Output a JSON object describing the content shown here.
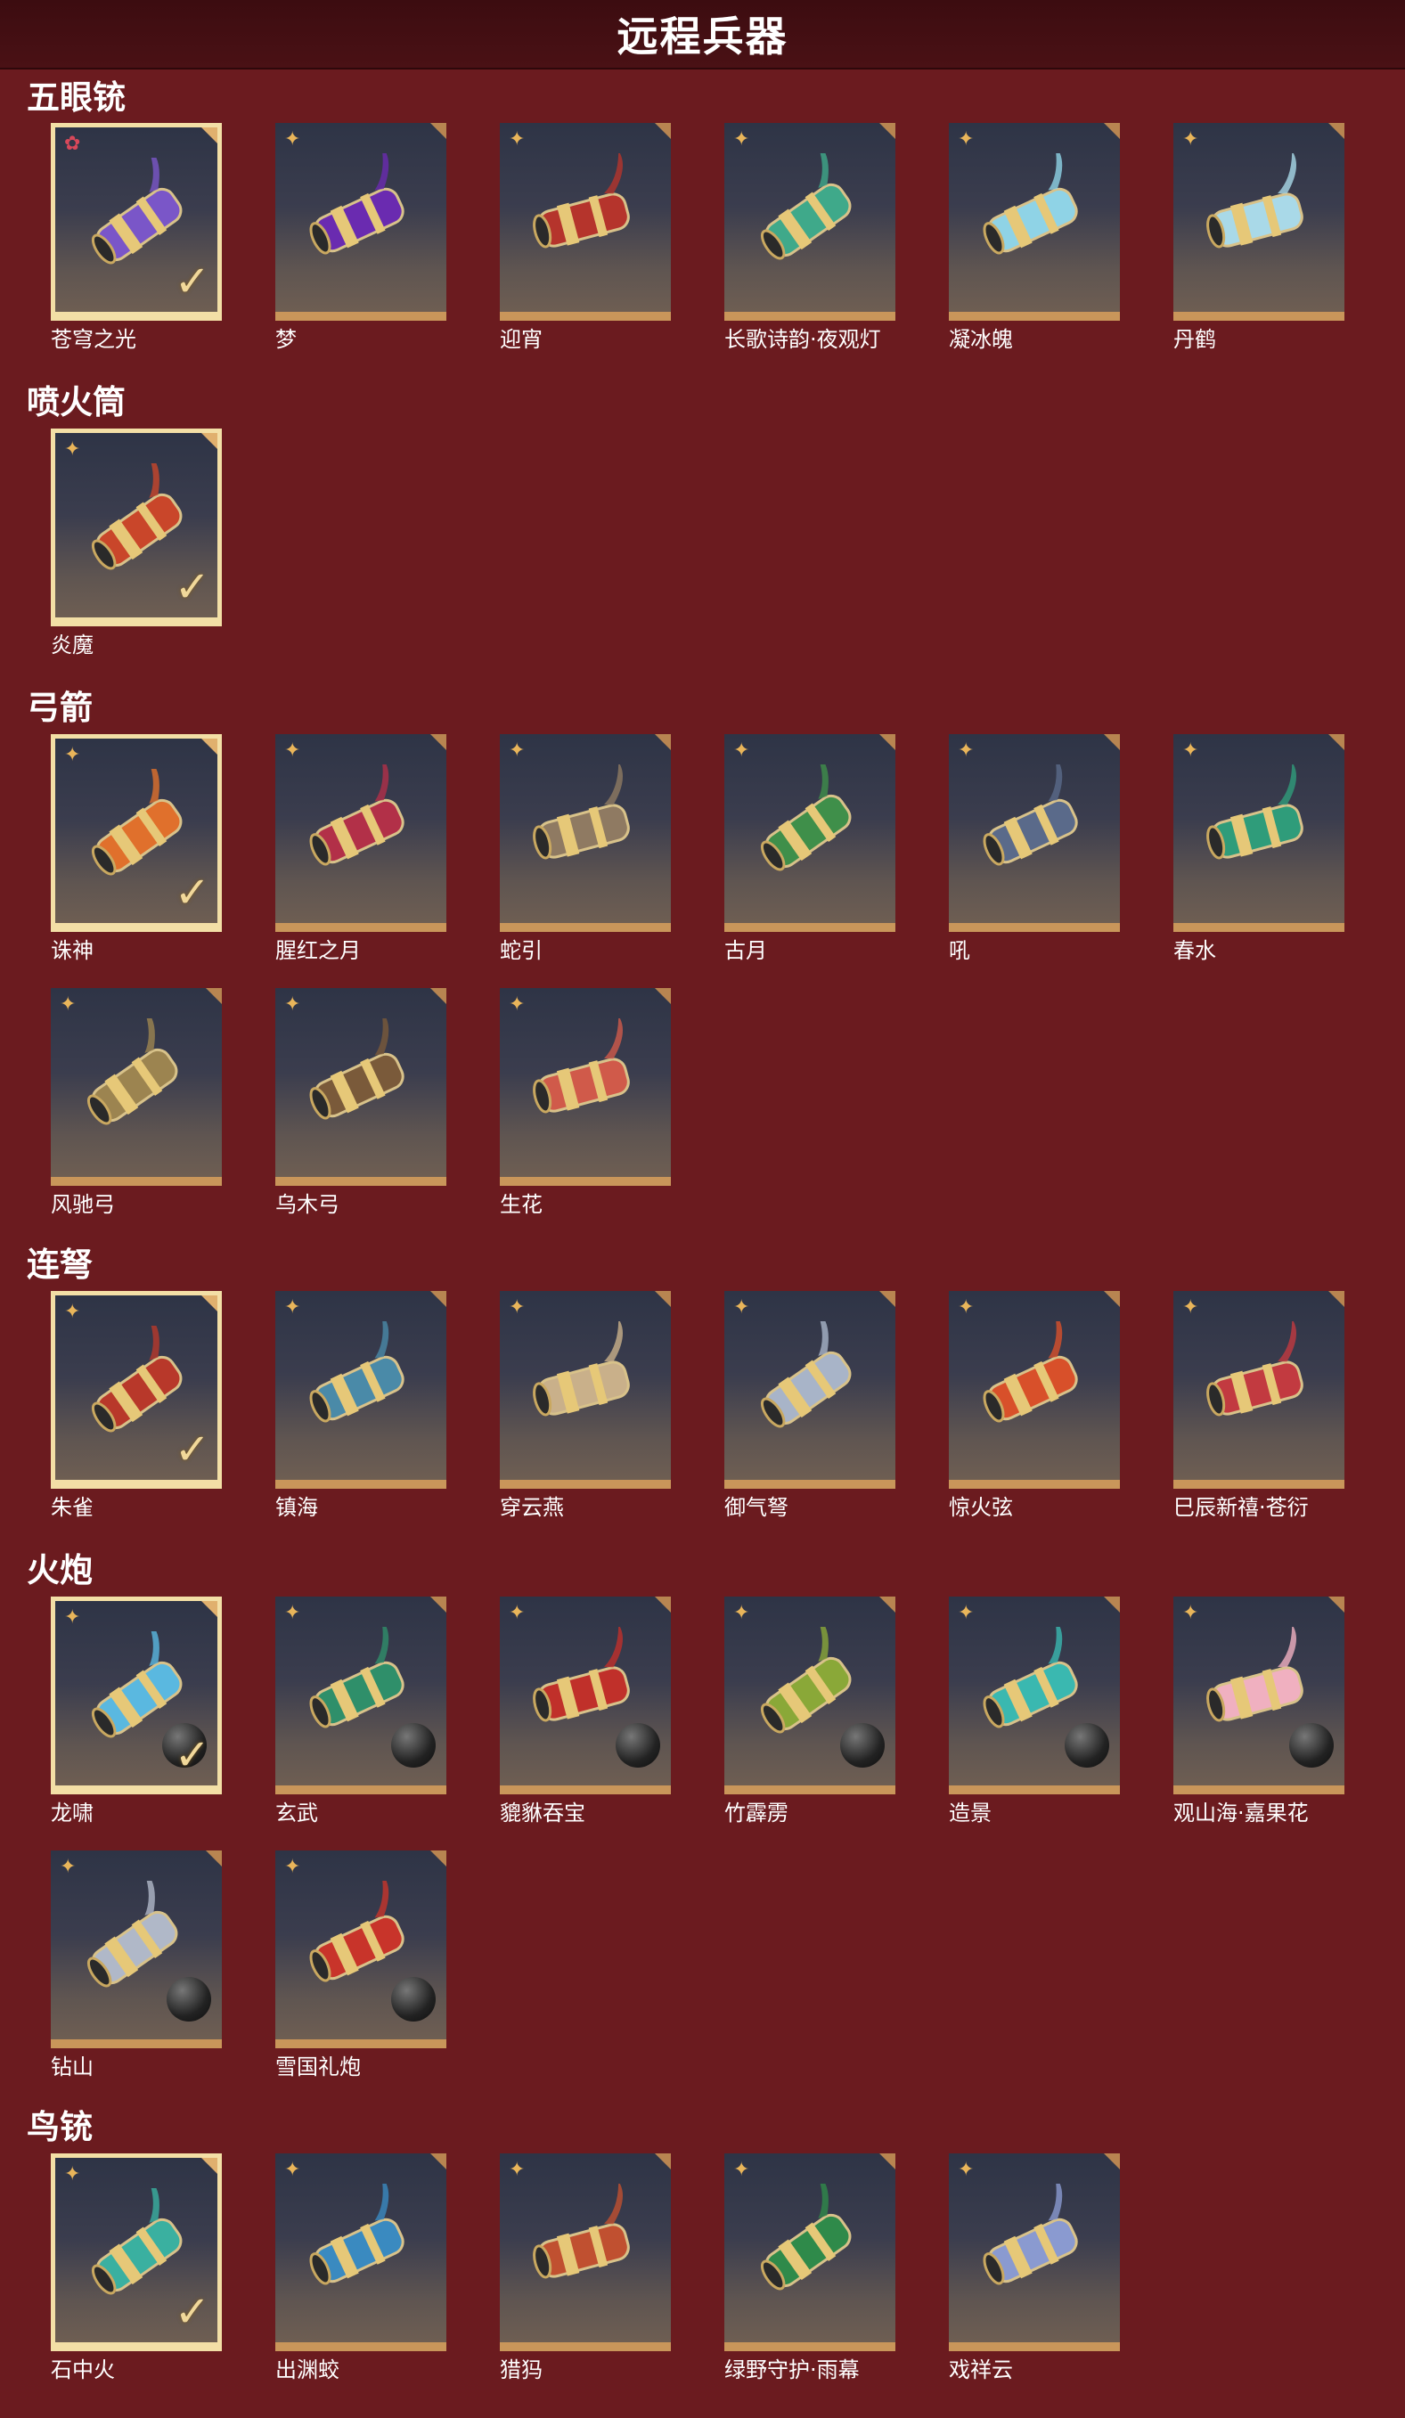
{
  "page_title": "远程兵器",
  "sections": [
    {
      "title": "五眼铳",
      "items": [
        {
          "name": "苍穹之光",
          "selected": true,
          "rarity": "red",
          "color": "#7a56c8"
        },
        {
          "name": "梦",
          "color": "#6a2bb0"
        },
        {
          "name": "迎宵",
          "color": "#b5342c"
        },
        {
          "name": "长歌诗韵·夜观灯",
          "color": "#3fa98a"
        },
        {
          "name": "凝冰魄",
          "color": "#8fd3e6"
        },
        {
          "name": "丹鹤",
          "color": "#a9d9e8"
        }
      ]
    },
    {
      "title": "喷火筒",
      "items": [
        {
          "name": "炎魔",
          "selected": true,
          "color": "#c9462a"
        }
      ]
    },
    {
      "title": "弓箭",
      "items": [
        {
          "name": "诛神",
          "selected": true,
          "color": "#e0702c"
        },
        {
          "name": "腥红之月",
          "color": "#b23048"
        },
        {
          "name": "蛇引",
          "color": "#8f7a62"
        },
        {
          "name": "古月",
          "color": "#3f8f4a"
        },
        {
          "name": "吼",
          "color": "#5a6a8a"
        },
        {
          "name": "春水",
          "color": "#2f9c7a"
        },
        {
          "name": "风驰弓",
          "color": "#9c8450"
        },
        {
          "name": "乌木弓",
          "color": "#7a5a3a"
        },
        {
          "name": "生花",
          "color": "#d05a4a"
        }
      ]
    },
    {
      "title": "连弩",
      "items": [
        {
          "name": "朱雀",
          "selected": true,
          "color": "#b8382a"
        },
        {
          "name": "镇海",
          "color": "#4a8aa8"
        },
        {
          "name": "穿云燕",
          "color": "#c9b08a"
        },
        {
          "name": "御气弩",
          "color": "#a8b4c8"
        },
        {
          "name": "惊火弦",
          "color": "#d8502a"
        },
        {
          "name": "巳辰新禧·苍衍",
          "color": "#c23a40"
        }
      ]
    },
    {
      "title": "火炮",
      "items": [
        {
          "name": "龙啸",
          "selected": true,
          "ball": true,
          "color": "#5ab8e0"
        },
        {
          "name": "玄武",
          "ball": true,
          "color": "#2f8f6a"
        },
        {
          "name": "貔貅吞宝",
          "ball": true,
          "color": "#c0302a"
        },
        {
          "name": "竹霹雳",
          "ball": true,
          "color": "#8aa838"
        },
        {
          "name": "造景",
          "ball": true,
          "color": "#3ab8b0"
        },
        {
          "name": "观山海·嘉果花",
          "ball": true,
          "color": "#f0b0c0"
        },
        {
          "name": "钻山",
          "ball": true,
          "color": "#b0b8c8"
        },
        {
          "name": "雪国礼炮",
          "ball": true,
          "color": "#c8342a"
        }
      ]
    },
    {
      "title": "鸟铳",
      "items": [
        {
          "name": "石中火",
          "selected": true,
          "color": "#3ab0a0"
        },
        {
          "name": "出渊蛟",
          "color": "#3a8ac0"
        },
        {
          "name": "猎犸",
          "color": "#c05030"
        },
        {
          "name": "绿野守护·雨幕",
          "color": "#2f8a4a"
        },
        {
          "name": "戏祥云",
          "color": "#8a9ad0"
        }
      ]
    }
  ]
}
